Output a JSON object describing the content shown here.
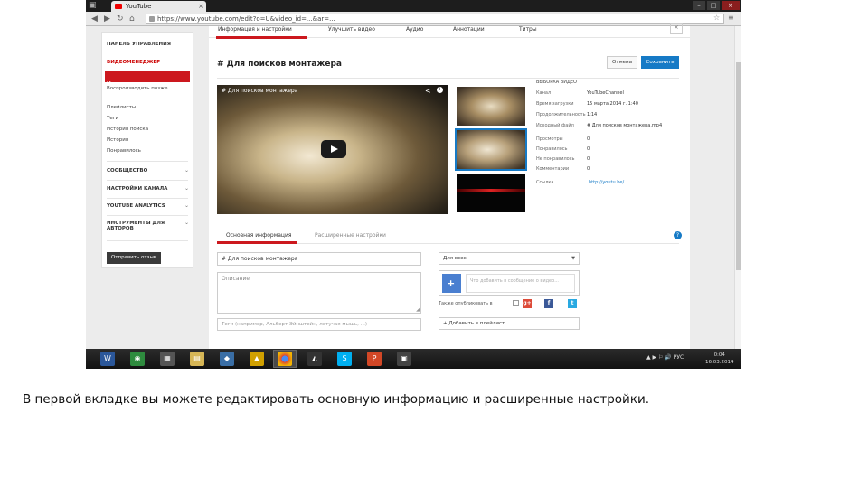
{
  "browser": {
    "tab_title": "YouTube",
    "tab_close": "×",
    "url": "https://www.youtube.com/edit?o=U&video_id=...&ar=...",
    "window_buttons": [
      "–",
      "□",
      "×"
    ]
  },
  "sidebar": {
    "dashboard": "ПАНЕЛЬ УПРАВЛЕНИЯ",
    "video_manager": "ВИДЕОМЕНЕДЖЕР",
    "items": [
      "Мои видео",
      "Воспроизводить позже",
      "Плейлисты",
      "Теги",
      "История поиска",
      "История",
      "Понравилось"
    ],
    "community": "СООБЩЕСТВО",
    "channel_settings": "НАСТРОЙКИ КАНАЛА",
    "analytics": "YOUTUBE ANALYTICS",
    "creator_tools": "ИНСТРУМЕНТЫ ДЛЯ АВТОРОВ",
    "send_feedback": "Отправить отзыв"
  },
  "topnav": [
    "Информация и настройки",
    "Улучшить видео",
    "Аудио",
    "Аннотации",
    "Титры"
  ],
  "video": {
    "title": "# Для поисков монтажера",
    "player_title": "# Для поисков монтажера",
    "cancel": "Отмена",
    "save": "Сохранить"
  },
  "meta": {
    "header": "ВЫБОРКА ВИДЕО",
    "labels": [
      "Канал",
      "Время загрузки",
      "Продолжительность",
      "Исходный файл"
    ],
    "values": [
      "YouTubeChannel",
      "15 марта 2014 г. 1:40",
      "1:14",
      "# Для поисков монтажера.mp4"
    ],
    "stats_labels": [
      "Просмотры",
      "Понравилось",
      "Не понравилось",
      "Комментарии"
    ],
    "stats_values": [
      "0",
      "0",
      "0",
      "0"
    ],
    "link_label": "Ссылка",
    "link_value": "http://youtu.be/..."
  },
  "tabs2": {
    "basic": "Основная информация",
    "advanced": "Расширенные настройки",
    "help": "?"
  },
  "form": {
    "title_value": "# Для поисков монтажера",
    "desc_placeholder": "Описание",
    "tags_placeholder": "Теги (например, Альберт Эйнштейн, летучая мышь, ...)",
    "privacy": "Для всех",
    "share_placeholder": "Что добавить в сообщение о видео...",
    "share_label": "Также опубликовать в",
    "playlist": "+ Добавить в плейлист"
  },
  "taskbar": {
    "tray": "▲ ▶ ⚐ 🔊 РУС",
    "time": "0:04",
    "date": "16.03.2014"
  },
  "caption": "В первой вкладке вы можете редактировать основную информацию и расширенные настройки."
}
